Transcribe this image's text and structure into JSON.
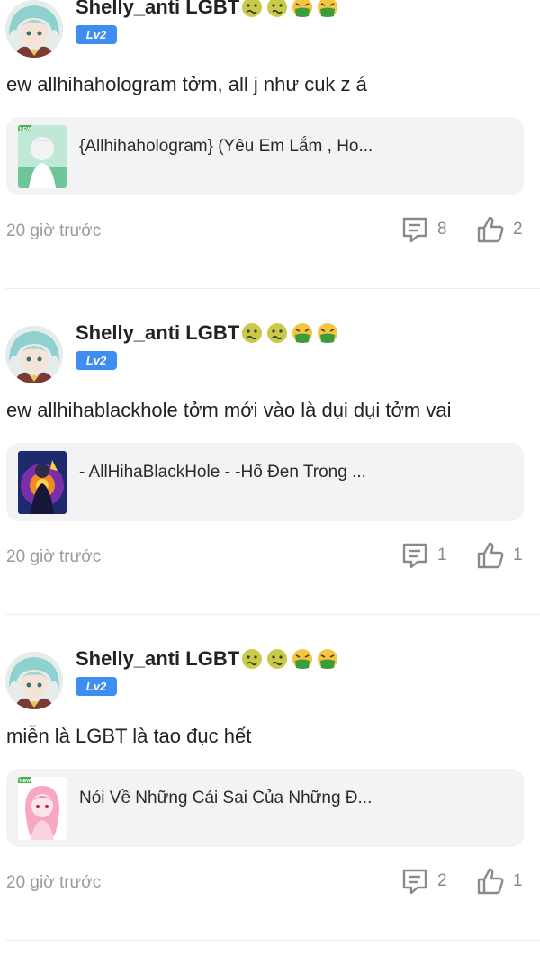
{
  "posts": [
    {
      "username": "Shelly_anti LGBT",
      "emojis": [
        "sick-face-icon",
        "sick-face-icon",
        "vomiting-face-icon",
        "vomiting-face-icon"
      ],
      "level": "Lv2",
      "comment": "ew allhihahologram tởm, all j như cuk z á",
      "story_title": "{Allhihahologram} (Yêu Em Lắm , Ho...",
      "story_badge": "NEW",
      "time": "20 giờ trước",
      "reply_count": "8",
      "like_count": "2"
    },
    {
      "username": "Shelly_anti LGBT",
      "emojis": [
        "sick-face-icon",
        "sick-face-icon",
        "vomiting-face-icon",
        "vomiting-face-icon"
      ],
      "level": "Lv2",
      "comment": "ew allhihablackhole tởm mới vào là dụi dụi tởm vai",
      "story_title": "- AllHihaBlackHole - -Hố Đen Trong ...",
      "story_badge": "",
      "time": "20 giờ trước",
      "reply_count": "1",
      "like_count": "1"
    },
    {
      "username": "Shelly_anti LGBT",
      "emojis": [
        "sick-face-icon",
        "sick-face-icon",
        "vomiting-face-icon",
        "vomiting-face-icon"
      ],
      "level": "Lv2",
      "comment": "miễn là LGBT là tao đục hết",
      "story_title": "Nói Về Những Cái Sai Của Những Đ...",
      "story_badge": "NEW",
      "time": "20 giờ trước",
      "reply_count": "2",
      "like_count": "1"
    }
  ],
  "colors": {
    "level_badge": "#3d8ef0",
    "card_bg": "#f3f3f5",
    "muted_text": "#9a9a9a",
    "sick_face": "#c9c94a",
    "vomit_face": "#3a9c3a"
  }
}
